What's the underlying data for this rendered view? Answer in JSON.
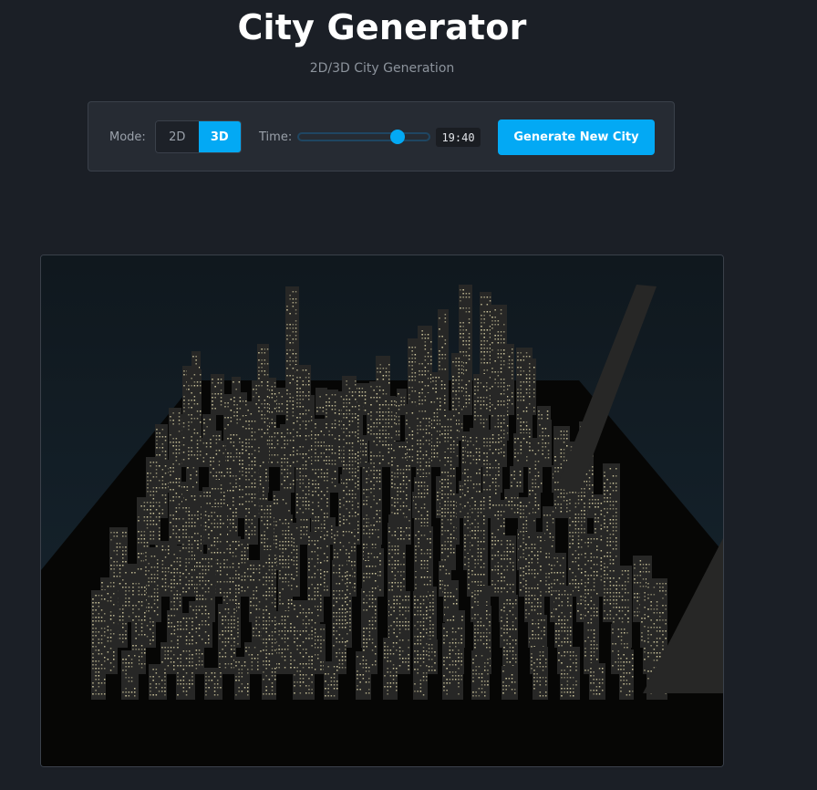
{
  "header": {
    "title": "City Generator",
    "subtitle": "2D/3D City Generation"
  },
  "controls": {
    "mode_label": "Mode:",
    "mode_options": [
      "2D",
      "3D"
    ],
    "mode_selected": "3D",
    "time_label": "Time:",
    "time_value": "19:40",
    "time_fraction": 0.82,
    "generate_label": "Generate New City"
  },
  "scene": {
    "sky_color": "#10181e",
    "horizon_color": "#162631",
    "ground_color": "#060605",
    "building_color": "#272726",
    "window_color": "#d8d0a4"
  }
}
